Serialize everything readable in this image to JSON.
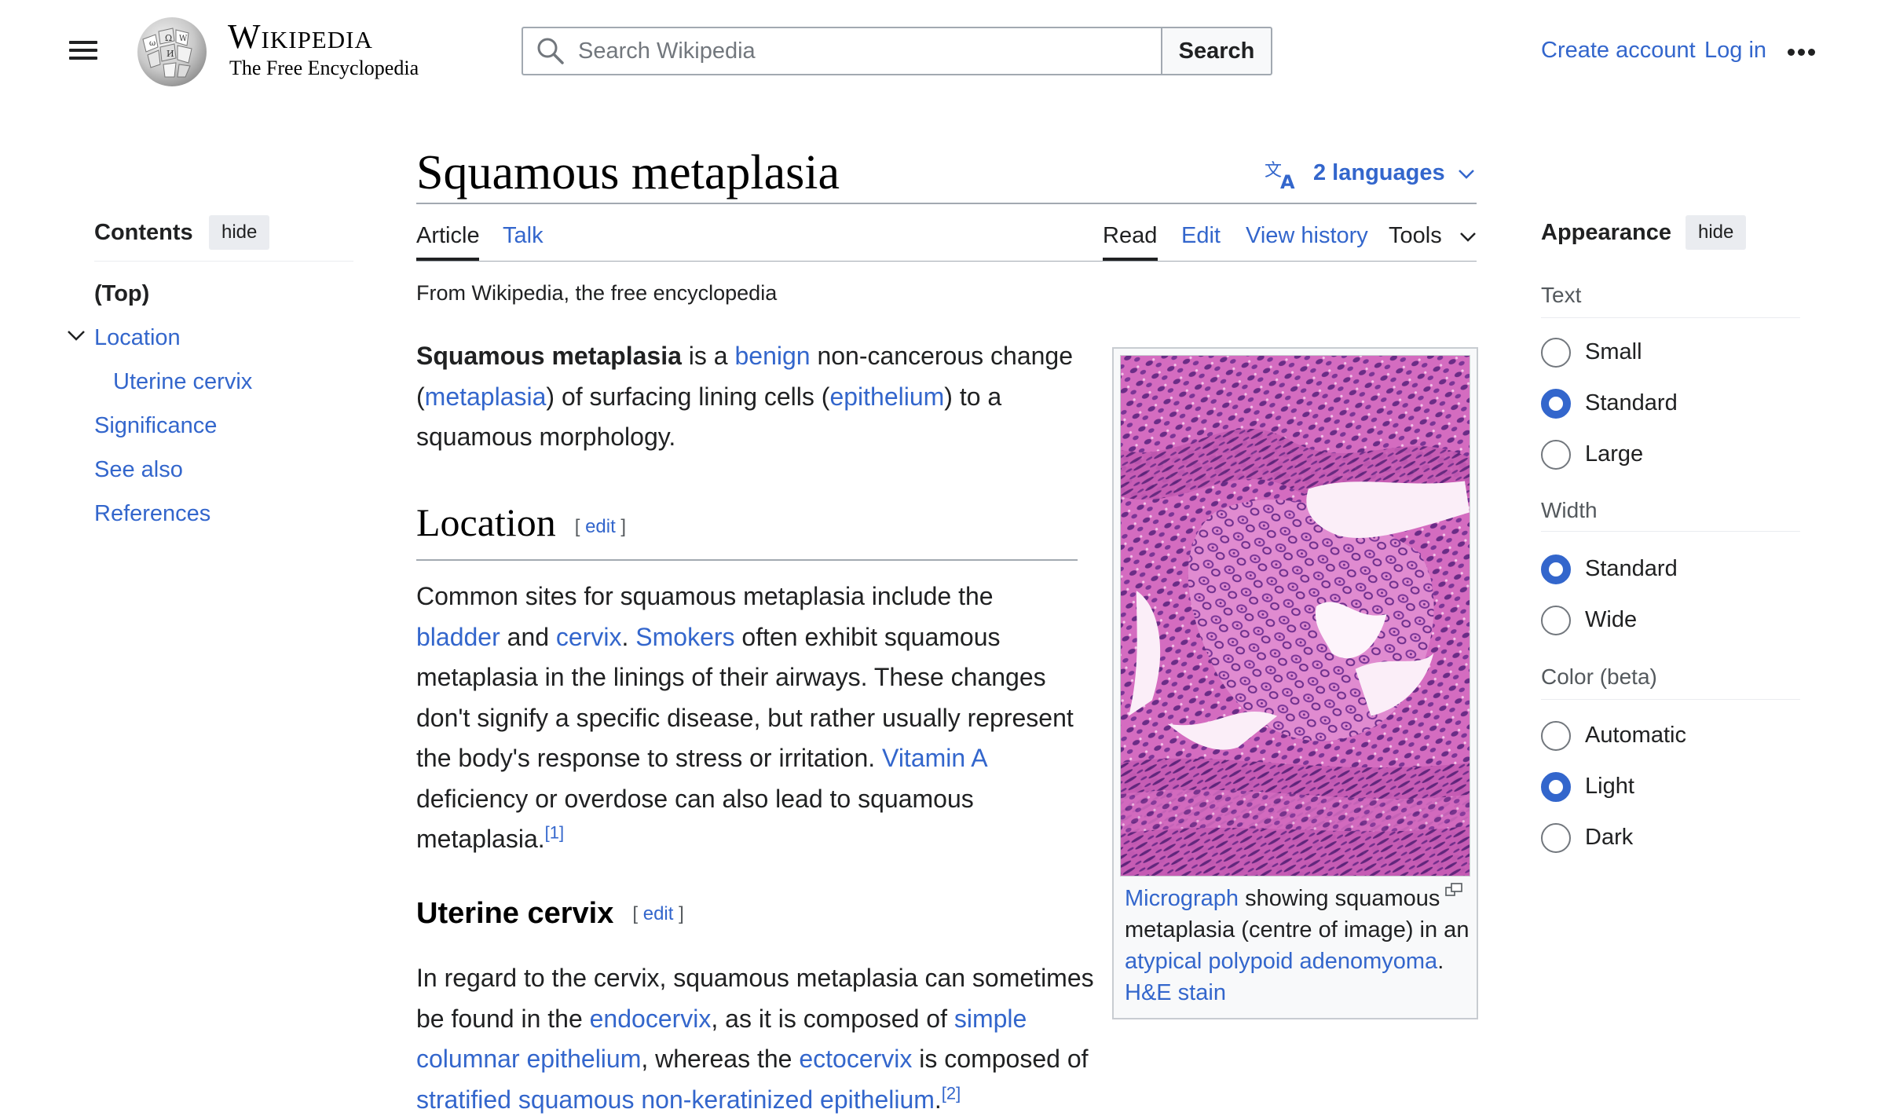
{
  "header": {
    "wordmark": "Wikipedia",
    "tagline": "The Free Encyclopedia",
    "search": {
      "placeholder": "Search Wikipedia",
      "button_label": "Search"
    },
    "create_account": "Create account",
    "log_in": "Log in"
  },
  "toc": {
    "title": "Contents",
    "hide_label": "hide",
    "top": "(Top)",
    "items": [
      {
        "label": "Location"
      },
      {
        "label": "Uterine cervix"
      },
      {
        "label": "Significance"
      },
      {
        "label": "See also"
      },
      {
        "label": "References"
      }
    ]
  },
  "article": {
    "title": "Squamous metaplasia",
    "languages": "2 languages",
    "tabs": {
      "article": "Article",
      "talk": "Talk",
      "read": "Read",
      "edit": "Edit",
      "history": "View history",
      "tools": "Tools"
    },
    "from": "From Wikipedia, the free encyclopedia",
    "intro": {
      "bold": "Squamous metaplasia",
      "t1": " is a ",
      "l1": "benign",
      "t2": " non-cancerous change (",
      "l2": "metaplasia",
      "t3": ") of surfacing lining cells (",
      "l3": "epithelium",
      "t4": ") to a squamous morphology."
    },
    "edit_open": "[ ",
    "edit_link": "edit",
    "edit_close": " ]",
    "location": {
      "heading": "Location",
      "t1": "Common sites for squamous metaplasia include the ",
      "l1": "bladder",
      "t2": " and ",
      "l2": "cervix",
      "t3": ". ",
      "l3": "Smokers",
      "t4": " often exhibit squamous metaplasia in the linings of their airways. These changes don't signify a specific disease, but rather usually represent the body's response to stress or irritation. ",
      "l4": "Vitamin A",
      "t5": " deficiency or overdose can also lead to squamous metaplasia.",
      "ref": "[1]"
    },
    "uterine": {
      "heading": "Uterine cervix",
      "t1": "In regard to the cervix, squamous metaplasia can sometimes be found in the ",
      "l1": "endocervix",
      "t2": ", as it is composed of ",
      "l2": "simple columnar epithelium",
      "t3": ", whereas the ",
      "l3": "ectocervix",
      "t4": " is composed of ",
      "l4": "stratified squamous non-keratinized epithelium",
      "t5": ".",
      "ref": "[2]"
    },
    "figure": {
      "l1": "Micrograph",
      "t1": " showing squamous metaplasia (centre of image) in an ",
      "l2": "atypical polypoid adenomyoma",
      "t2": ". ",
      "l3": "H&E stain"
    }
  },
  "appearance": {
    "title": "Appearance",
    "hide_label": "hide",
    "text_label": "Text",
    "text_options": [
      "Small",
      "Standard",
      "Large"
    ],
    "text_selected": "Standard",
    "width_label": "Width",
    "width_options": [
      "Standard",
      "Wide"
    ],
    "width_selected": "Standard",
    "color_label": "Color (beta)",
    "color_options": [
      "Automatic",
      "Light",
      "Dark"
    ],
    "color_selected": "Light"
  },
  "colors": {
    "link": "#3366cc",
    "text": "#202122",
    "accent": "#3366cc",
    "tissue_pink": "#d47fc4",
    "tissue_purple": "#5a2a7a"
  },
  "icons": [
    "menu-icon",
    "wikipedia-globe-logo",
    "search-icon",
    "ellipsis-icon",
    "translate-icon",
    "chevron-down-icon",
    "magnify-icon"
  ]
}
